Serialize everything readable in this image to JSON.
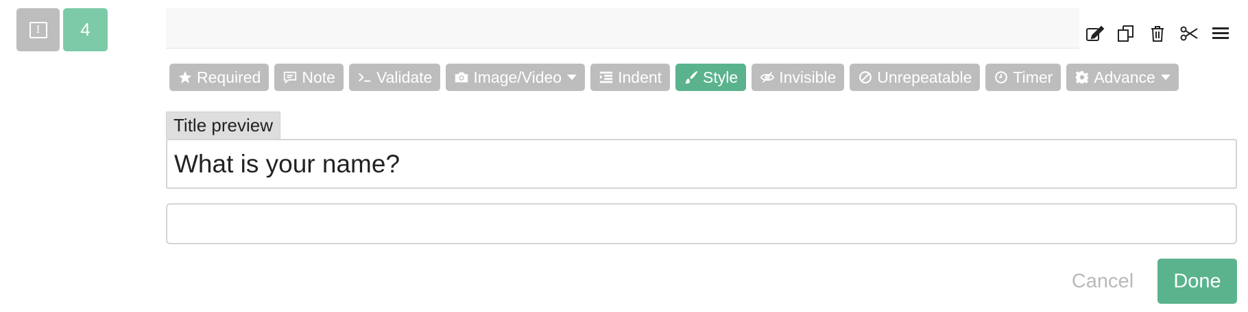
{
  "question": {
    "type_icon": "text-cursor-icon",
    "number": "4"
  },
  "header_tools": [
    {
      "name": "edit-icon"
    },
    {
      "name": "duplicate-icon"
    },
    {
      "name": "trash-icon"
    },
    {
      "name": "scissors-icon"
    },
    {
      "name": "menu-icon"
    }
  ],
  "toolbar": {
    "required": "Required",
    "note": "Note",
    "validate": "Validate",
    "media": "Image/Video",
    "indent": "Indent",
    "style": "Style",
    "invisible": "Invisible",
    "unrepeatable": "Unrepeatable",
    "timer": "Timer",
    "advance": "Advance"
  },
  "editor": {
    "title_preview_label": "Title preview",
    "title_value": "What is your name?",
    "description_value": ""
  },
  "actions": {
    "cancel": "Cancel",
    "done": "Done"
  },
  "colors": {
    "accent": "#5ab38d",
    "accent_light": "#7ccaa7",
    "button_gray": "#bdbdbd"
  }
}
